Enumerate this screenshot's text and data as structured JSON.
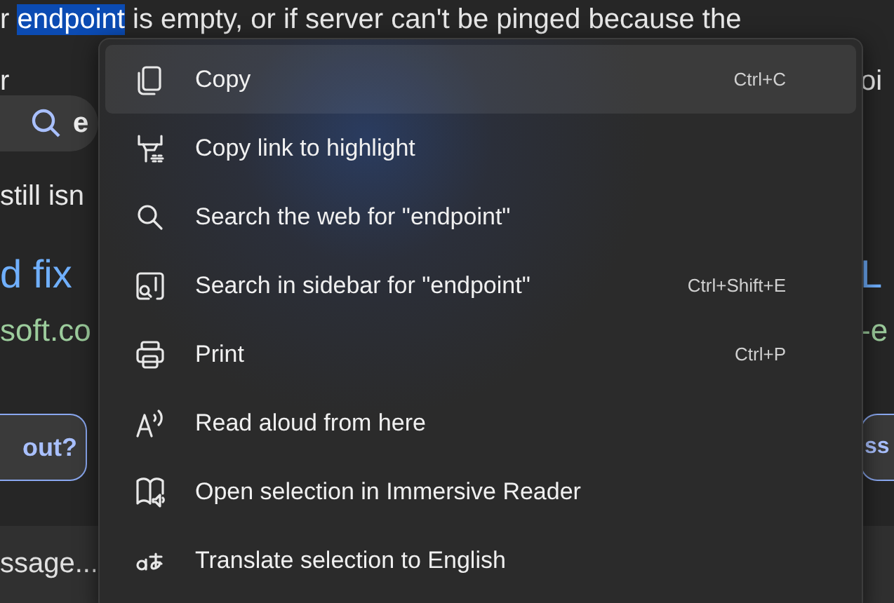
{
  "page": {
    "line_start": "r ",
    "selection": "endpoint",
    "line_rest": " is empty, or if server can't be pinged because the",
    "left_fragments": [
      "r",
      "still isn",
      "d fix",
      "soft.co"
    ],
    "right_fragments": [
      "oi",
      "L",
      "-e"
    ],
    "search": {
      "value": "e"
    },
    "left_button": "out?",
    "right_button": "ss",
    "message_field": {
      "placeholder": "ssage..."
    }
  },
  "context_menu": {
    "items": [
      {
        "label": "Copy",
        "shortcut": "Ctrl+C",
        "selected": true
      },
      {
        "label": "Copy link to highlight",
        "selected": false
      },
      {
        "label": "Search the web for \"endpoint\"",
        "selected": false
      },
      {
        "label": "Search in sidebar for \"endpoint\"",
        "shortcut": "Ctrl+Shift+E",
        "selected": false
      },
      {
        "label": "Print",
        "shortcut": "Ctrl+P",
        "selected": false
      },
      {
        "label": "Read aloud from here",
        "selected": false
      },
      {
        "label": "Open selection in Immersive Reader",
        "selected": false
      },
      {
        "label": "Translate selection to English",
        "selected": false
      }
    ]
  }
}
